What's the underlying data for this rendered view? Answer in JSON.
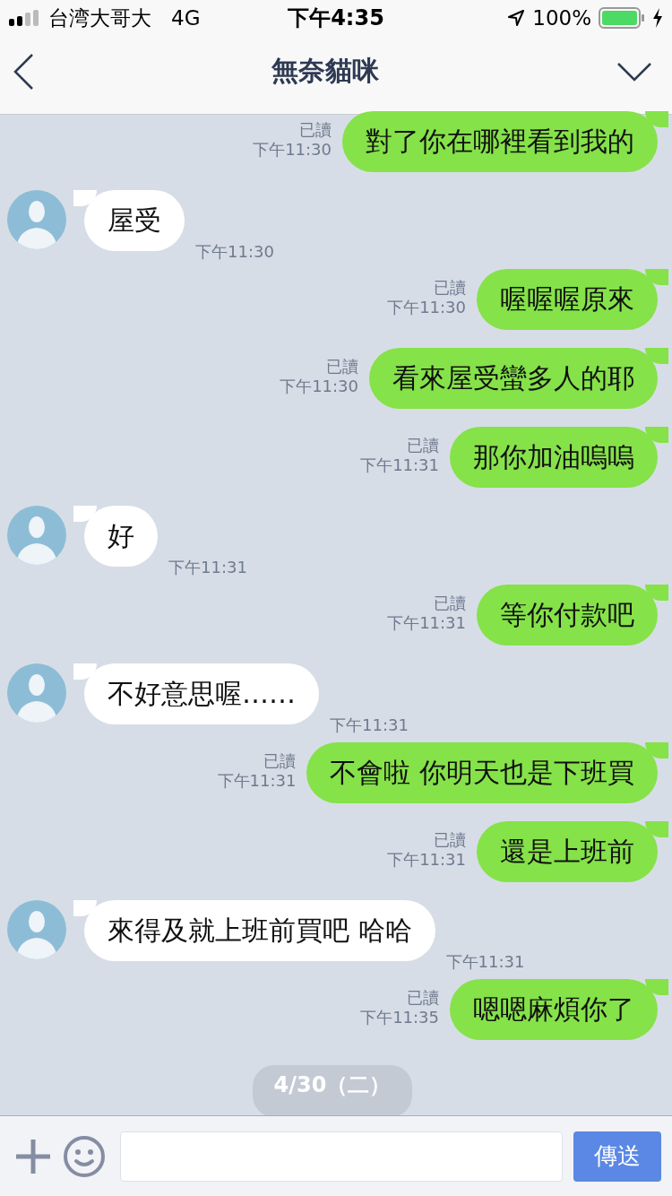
{
  "status_bar": {
    "carrier": "台湾大哥大",
    "network": "4G",
    "time": "下午4:35",
    "battery": "100%"
  },
  "header": {
    "title": "無奈貓咪"
  },
  "messages": [
    {
      "kind": "sent",
      "text": "對了你在哪裡看到我的",
      "read": "已讀",
      "time": "下午11:30"
    },
    {
      "kind": "received",
      "text": "屋受",
      "time": "下午11:30"
    },
    {
      "kind": "sent",
      "text": "喔喔喔原來",
      "read": "已讀",
      "time": "下午11:30"
    },
    {
      "kind": "sent",
      "text": "看來屋受蠻多人的耶",
      "read": "已讀",
      "time": "下午11:30"
    },
    {
      "kind": "sent",
      "text": "那你加油嗚嗚",
      "read": "已讀",
      "time": "下午11:31"
    },
    {
      "kind": "received",
      "text": "好",
      "time": "下午11:31"
    },
    {
      "kind": "sent",
      "text": "等你付款吧",
      "read": "已讀",
      "time": "下午11:31"
    },
    {
      "kind": "received",
      "text": "不好意思喔……",
      "time": "下午11:31"
    },
    {
      "kind": "sent",
      "text": "不會啦 你明天也是下班買",
      "read": "已讀",
      "time": "下午11:31"
    },
    {
      "kind": "sent",
      "text": "還是上班前",
      "read": "已讀",
      "time": "下午11:31"
    },
    {
      "kind": "received",
      "text": "來得及就上班前買吧 哈哈",
      "time": "下午11:31"
    },
    {
      "kind": "sent",
      "text": "嗯嗯麻煩你了",
      "read": "已讀",
      "time": "下午11:35"
    }
  ],
  "date_divider": "4/30（二）",
  "composer": {
    "send_button": "傳送"
  }
}
